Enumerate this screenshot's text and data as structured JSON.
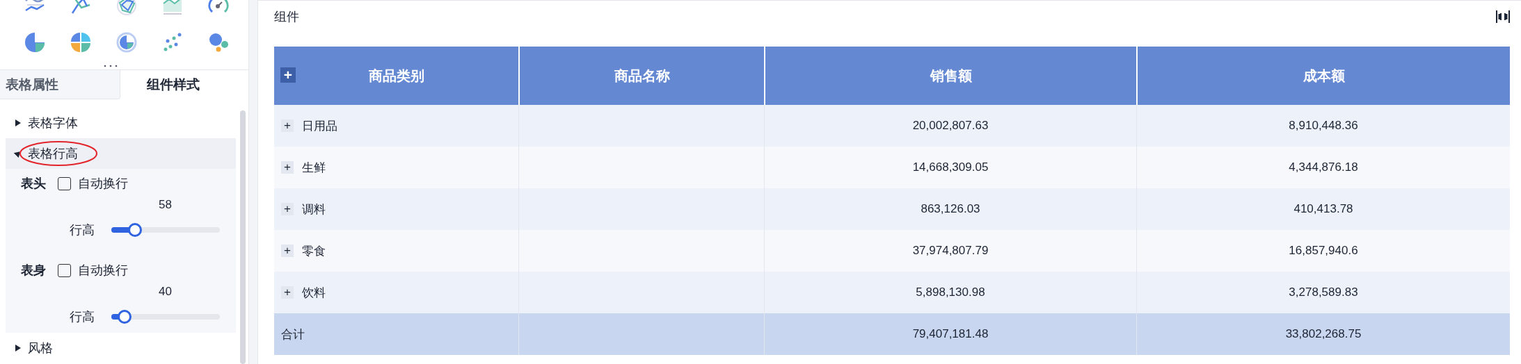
{
  "panel": {
    "tabs": [
      {
        "label": "表格属性",
        "selected": false
      },
      {
        "label": "组件样式",
        "selected": true
      }
    ],
    "sections": [
      {
        "label": "表格字体",
        "expanded": false,
        "circled": false
      },
      {
        "label": "表格行高",
        "expanded": true,
        "circled": true,
        "groups": [
          {
            "label": "表头",
            "auto_wrap": {
              "label": "自动换行",
              "checked": false
            },
            "value": "58",
            "slider_label": "行高",
            "level": 0.22
          },
          {
            "label": "表身",
            "auto_wrap": {
              "label": "自动换行",
              "checked": false
            },
            "value": "40",
            "slider_label": "行高",
            "level": 0.12
          }
        ]
      },
      {
        "label": "风格",
        "expanded": false,
        "circled": false
      }
    ]
  },
  "component": {
    "title": "组件",
    "table": {
      "header_expand": "+",
      "columns": [
        "商品类别",
        "商品名称",
        "销售额",
        "成本额"
      ],
      "rows": [
        {
          "expand": "+",
          "category": "日用品",
          "sales": "20,002,807.63",
          "cost": "8,910,448.36"
        },
        {
          "expand": "+",
          "category": "生鲜",
          "sales": "14,668,309.05",
          "cost": "4,344,876.18"
        },
        {
          "expand": "+",
          "category": "调料",
          "sales": "863,126.03",
          "cost": "410,413.78"
        },
        {
          "expand": "+",
          "category": "零食",
          "sales": "37,974,807.79",
          "cost": "16,857,940.6"
        },
        {
          "expand": "+",
          "category": "饮料",
          "sales": "5,898,130.98",
          "cost": "3,278,589.83"
        }
      ],
      "total": {
        "label": "合计",
        "sales": "79,407,181.48",
        "cost": "33,802,268.75"
      }
    }
  }
}
